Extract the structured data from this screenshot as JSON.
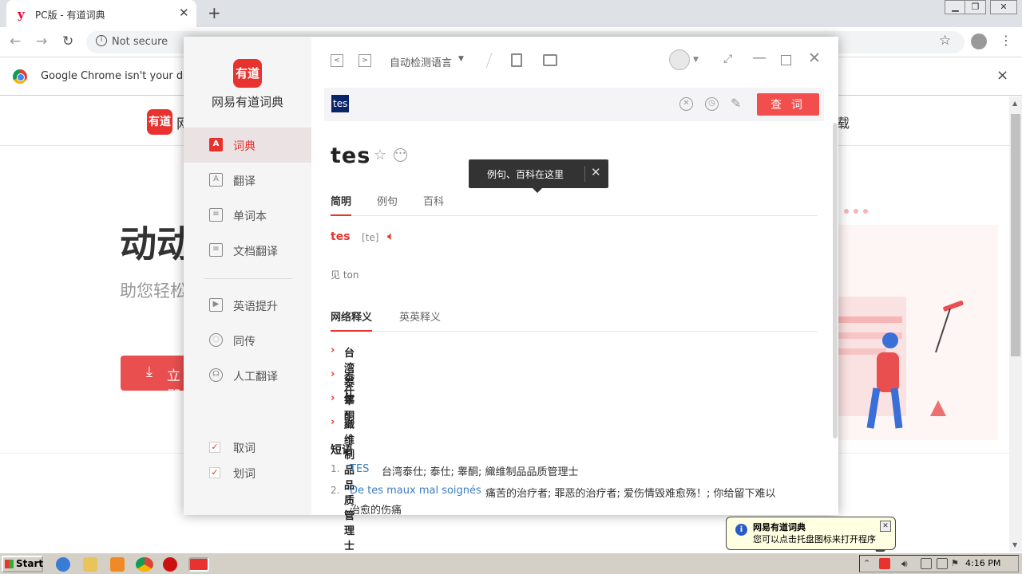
{
  "browser": {
    "tab_title": "PC版 - 有道词典",
    "tab_favicon": "y",
    "newtab_label": "+",
    "not_secure": "Not secure",
    "infobar_text": "Google Chrome isn't your default",
    "infobar_close": "×"
  },
  "page": {
    "logo_text": "有道",
    "logo_char": "网",
    "nav_right": "载",
    "headline": "动动",
    "subline": "助您轻松",
    "download_label": "立即"
  },
  "app": {
    "name": "网易有道词典",
    "logo_text": "有道",
    "sidebar": {
      "items": [
        {
          "label": "词典",
          "icon": "A",
          "active": true
        },
        {
          "label": "翻译",
          "icon": "A"
        },
        {
          "label": "单词本",
          "icon": "≡"
        },
        {
          "label": "文档翻译",
          "icon": "≡"
        },
        {
          "label": "英语提升",
          "icon": "▶"
        },
        {
          "label": "同传",
          "icon": "◌"
        },
        {
          "label": "人工翻译",
          "icon": "☊"
        }
      ],
      "checks": [
        {
          "label": "取词",
          "checked": true
        },
        {
          "label": "划词",
          "checked": true
        }
      ]
    },
    "topbar": {
      "lang_select": "自动检测语言"
    },
    "search": {
      "value": "tes",
      "button": "查 词"
    },
    "word": "tes",
    "tooltip": "例句、百科在这里",
    "tabs1": [
      "简明",
      "例句",
      "百科"
    ],
    "head_word": "tes",
    "phonetic": "[te]",
    "see_also": "见 ton",
    "tabs2": [
      "网络释义",
      "英英释义"
    ],
    "definitions": [
      "台湾泰仕",
      "泰仕",
      "睾酮",
      "織维制品品质管理士"
    ],
    "phrase_title": "短语",
    "phrases": [
      {
        "num": "1.",
        "term": "TES",
        "def": "台湾泰仕;  泰仕;  睾酮;  織维制品品质管理士",
        "def2": ""
      },
      {
        "num": "2.",
        "term": "De tes maux mal soignés",
        "def": "痛苦的治疗者;  罪恶的治疗者;  爱伤情毁难愈殇！;  你给留下难以",
        "def2": "治愈的伤痛"
      }
    ]
  },
  "balloon": {
    "title": "网易有道词典",
    "text": "您可以点击托盘图标来打开程序"
  },
  "taskbar": {
    "start": "Start",
    "clock": "4:16 PM"
  }
}
